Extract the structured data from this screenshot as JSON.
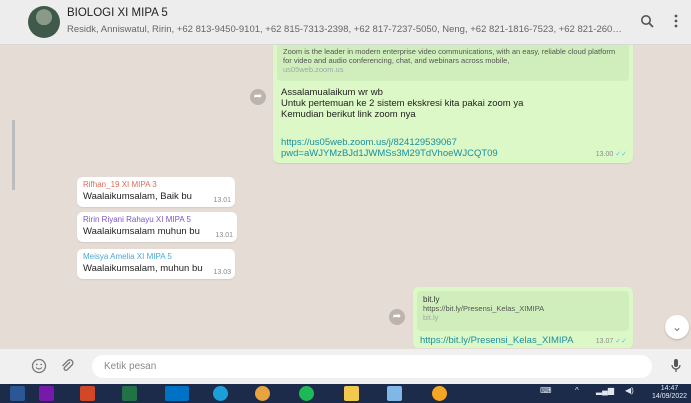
{
  "header": {
    "group_name": "BIOLOGI XI MIPA 5",
    "members": "Residk, Anniswatul, Ririn, +62 813-9450-9101, +62 815-7313-2398, +62 817-7237-5050, Neng, +62 821-1816-7523, +62 821-2606-9..."
  },
  "messages": {
    "zoom_preview": "Zoom is the leader in modern enterprise video communications, with an easy, reliable cloud platform for video and audio conferencing, chat, and webinars across mobile,",
    "zoom_preview_domain": "us05web.zoom.us",
    "zoom_line1": "Assalamualaikum wr wb",
    "zoom_line2": "Untuk pertemuan ke 2 sistem ekskresi kita pakai zoom ya",
    "zoom_line3": "Kemudian berikut link zoom nya",
    "zoom_link1": "https://us05web.zoom.us/j/824129539067",
    "zoom_link2": "pwd=aWJYMzBJd1JWMSs3M29TdVhoeWJCQT09",
    "zoom_time": "13.00",
    "msg1_sender": "Rifhan_19 XI MIPA 3",
    "msg1_text": "Waalaikumsalam, Baik bu",
    "msg1_time": "13.01",
    "msg2_sender": "Ririn Riyani Rahayu XI MIPA 5",
    "msg2_text": "Waalaikumsalam muhun bu",
    "msg2_time": "13.01",
    "msg3_sender": "Meisya Amelia XI MIPA 5",
    "msg3_text": "Waalaikumsalam, muhun bu",
    "msg3_time": "13.03",
    "bitly_title": "bit.ly",
    "bitly_url": "https://bit.ly/Presensi_Kelas_XIMIPA",
    "bitly_domain": "bit.ly",
    "bitly_link": "https://bit.ly/Presensi_Kelas_XIMIPA",
    "bitly_time": "13.07"
  },
  "composer": {
    "placeholder": "Ketik pesan"
  },
  "taskbar": {
    "time": "14:47",
    "date": "14/09/2022"
  },
  "colors": {
    "outgoing_bubble": "#dcf8c6",
    "incoming_bubble": "#ffffff",
    "chat_bg": "#e5ddd5",
    "read_ticks": "#4fc3f7",
    "link": "#1a8f9e",
    "sender1": "#e06b5a",
    "sender2": "#7a55c8",
    "sender3": "#4aa8d8"
  },
  "icons": [
    "search-icon",
    "menu-icon",
    "emoji-icon",
    "attach-icon",
    "mic-icon",
    "forward-icon",
    "chevron-down-icon"
  ]
}
